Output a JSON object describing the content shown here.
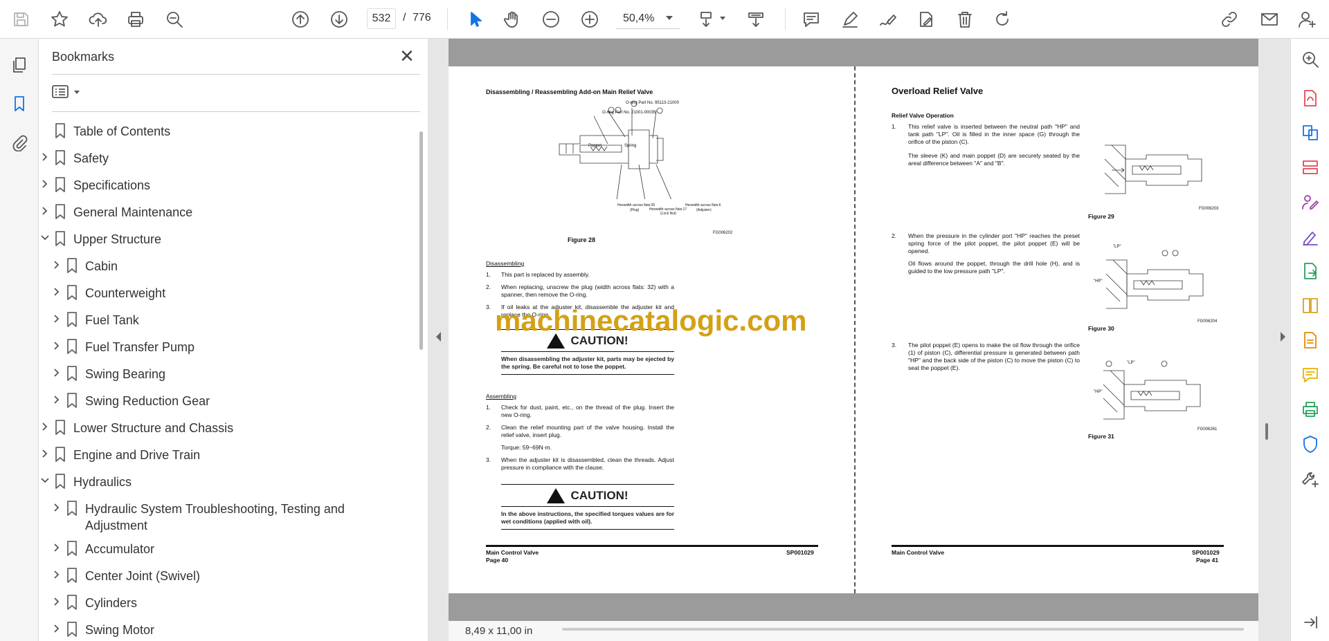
{
  "toolbar": {
    "page_current": "532",
    "page_separator": "/",
    "page_total": "776",
    "zoom": "50,4%"
  },
  "bookmarks": {
    "title": "Bookmarks",
    "close_glyph": "✕",
    "items": [
      {
        "label": "Table of Contents",
        "level": 0,
        "expander": "none"
      },
      {
        "label": "Safety",
        "level": 0,
        "expander": "collapsed"
      },
      {
        "label": "Specifications",
        "level": 0,
        "expander": "collapsed"
      },
      {
        "label": "General Maintenance",
        "level": 0,
        "expander": "collapsed"
      },
      {
        "label": "Upper Structure",
        "level": 0,
        "expander": "expanded"
      },
      {
        "label": "Cabin",
        "level": 1,
        "expander": "collapsed"
      },
      {
        "label": "Counterweight",
        "level": 1,
        "expander": "collapsed"
      },
      {
        "label": "Fuel Tank",
        "level": 1,
        "expander": "collapsed"
      },
      {
        "label": "Fuel Transfer Pump",
        "level": 1,
        "expander": "collapsed"
      },
      {
        "label": "Swing Bearing",
        "level": 1,
        "expander": "collapsed"
      },
      {
        "label": "Swing Reduction Gear",
        "level": 1,
        "expander": "collapsed"
      },
      {
        "label": "Lower Structure and Chassis",
        "level": 0,
        "expander": "collapsed"
      },
      {
        "label": "Engine and Drive Train",
        "level": 0,
        "expander": "collapsed"
      },
      {
        "label": "Hydraulics",
        "level": 0,
        "expander": "expanded"
      },
      {
        "label": "Hydraulic System Troubleshooting, Testing and Adjustment",
        "level": 1,
        "expander": "collapsed"
      },
      {
        "label": "Accumulator",
        "level": 1,
        "expander": "collapsed"
      },
      {
        "label": "Center Joint (Swivel)",
        "level": 1,
        "expander": "collapsed"
      },
      {
        "label": "Cylinders",
        "level": 1,
        "expander": "collapsed"
      },
      {
        "label": "Swing Motor",
        "level": 1,
        "expander": "collapsed"
      }
    ]
  },
  "document": {
    "left": {
      "heading": "Disassembling / Reassembling Add-on Main Relief Valve",
      "figure_labels": {
        "oring1": "O-ring Part No. 95113-21000",
        "oring2": "O-ring Part No. 21001-00035",
        "poppet": "Poppet",
        "spring": "Spring",
        "n1": "①",
        "n2": "②",
        "n3": "③",
        "n4": "④",
        "hex1": "Hexwidth across flats:26",
        "plug": "(Plug)",
        "hex2": "Hexwidth across flats:17",
        "locknut": "(Lock Nut)",
        "hex3": "Hexwidth across flats:6",
        "adjuster": "(Adjuster)",
        "code": "FG006202"
      },
      "figure_caption": "Figure 28",
      "disassembling_title": "Disassembling",
      "dis_steps": [
        {
          "n": "1.",
          "t": "This part is replaced by assembly."
        },
        {
          "n": "2.",
          "t": "When replacing, unscrew the plug (width across flats: 32) with a spanner, then remove the O-ring."
        },
        {
          "n": "3.",
          "t": "If oil leaks at the adjuster kit, disassemble the adjuster kit and replace the O-ring."
        }
      ],
      "caution1_title": "CAUTION!",
      "caution1_text": "When disassembling the adjuster kit, parts may be ejected by the spring. Be careful not to lose the poppet.",
      "assembling_title": "Assembling",
      "as_steps": [
        {
          "n": "1.",
          "t": "Check for dust, paint, etc., on the thread of the plug. Insert the new O-ring."
        },
        {
          "n": "2.",
          "t": "Clean the relief mounting part of the valve housing. Install the relief valve, insert plug."
        },
        {
          "n": "",
          "t": "Torque: 59~69N·m."
        },
        {
          "n": "3.",
          "t": "When the adjuster kit is disassembled, clean the threads. Adjust pressure in compliance with the clause."
        }
      ],
      "caution2_title": "CAUTION!",
      "caution2_text": "In the above instructions, the specified torques values are for wet conditions (applied with oil).",
      "footer_left": "Main Control Valve",
      "footer_page": "Page 40",
      "footer_right": "SP001029"
    },
    "right": {
      "heading": "Overload Relief Valve",
      "subheading": "Relief Valve Operation",
      "p1_n": "1.",
      "p1": "This relief valve is inserted between the neutral path \"HP\" and tank path \"LP\". Oil is filled in the inner space (G) through the orifice of the piston (C).",
      "p1b": "The sleeve (K) and main poppet (D) are securely seated by the areal difference between \"A\" and \"B\".",
      "fig29": "Figure 29",
      "fig29_code": "FG006203",
      "p2_n": "2.",
      "p2": "When the pressure in the cylinder port \"HP\" reaches the preset spring force of the pilot poppet, the pilot poppet (E) will be opened.",
      "p2b": "Oil flows around the poppet, through the drill hole (H), and is guided to the low pressure path \"LP\".",
      "fig30": "Figure 30",
      "fig30_code": "FG006204",
      "p3_n": "3.",
      "p3": "The pilot poppet (E) opens to make the oil flow through the orifice (1) of piston (C), differential pressure is generated between path \"HP\" and the back side of the piston (C) to move the piston (C) to seat the poppet (E).",
      "fig31": "Figure 31",
      "fig31_code": "FG006261",
      "lp": "\"LP\"",
      "hp": "\"HP\"",
      "footer_left": "Main Control Valve",
      "footer_page": "Page 41",
      "footer_right": "SP001029"
    }
  },
  "watermark": "machinecatalogic.com",
  "status": {
    "page_size": "8,49 x 11,00 in"
  },
  "colors": {
    "accent": "#1473e6",
    "watermark": "#d4a017",
    "right_rail": [
      "#e34850",
      "#1473e6",
      "#e34850",
      "#a13bb0",
      "#7a4fc7",
      "#26a15c",
      "#d9a21b",
      "#e58a00",
      "#e8b100",
      "#26a15c",
      "#1473e6",
      "#555555"
    ]
  }
}
